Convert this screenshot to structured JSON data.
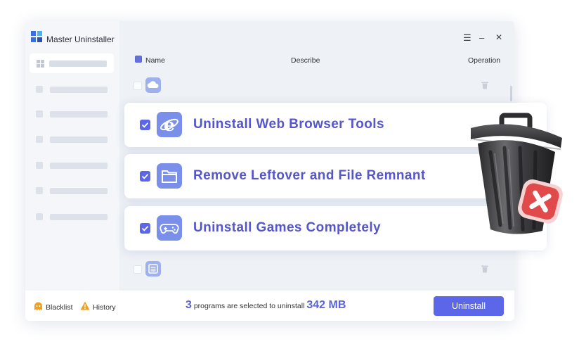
{
  "app": {
    "title": "Master Uninstaller"
  },
  "window_controls": {
    "menu": "☰",
    "minimize": "–",
    "close": "✕"
  },
  "columns": {
    "name": "Name",
    "describe": "Describe",
    "operation": "Operation"
  },
  "features": [
    {
      "label": "Uninstall Web Browser Tools",
      "icon": "browser-e-icon"
    },
    {
      "label": "Remove Leftover and File Remnant",
      "icon": "folder-icon"
    },
    {
      "label": "Uninstall Games Completely",
      "icon": "gamepad-icon"
    }
  ],
  "bottom": {
    "blacklist": "Blacklist",
    "history": "History",
    "count": "3",
    "status_text": "programs are selected to uninstall",
    "size": "342 MB",
    "uninstall_label": "Uninstall"
  },
  "colors": {
    "accent": "#5b67e8",
    "text_accent": "#5555cc",
    "warn": "#f0a020",
    "danger": "#e04a4a"
  }
}
